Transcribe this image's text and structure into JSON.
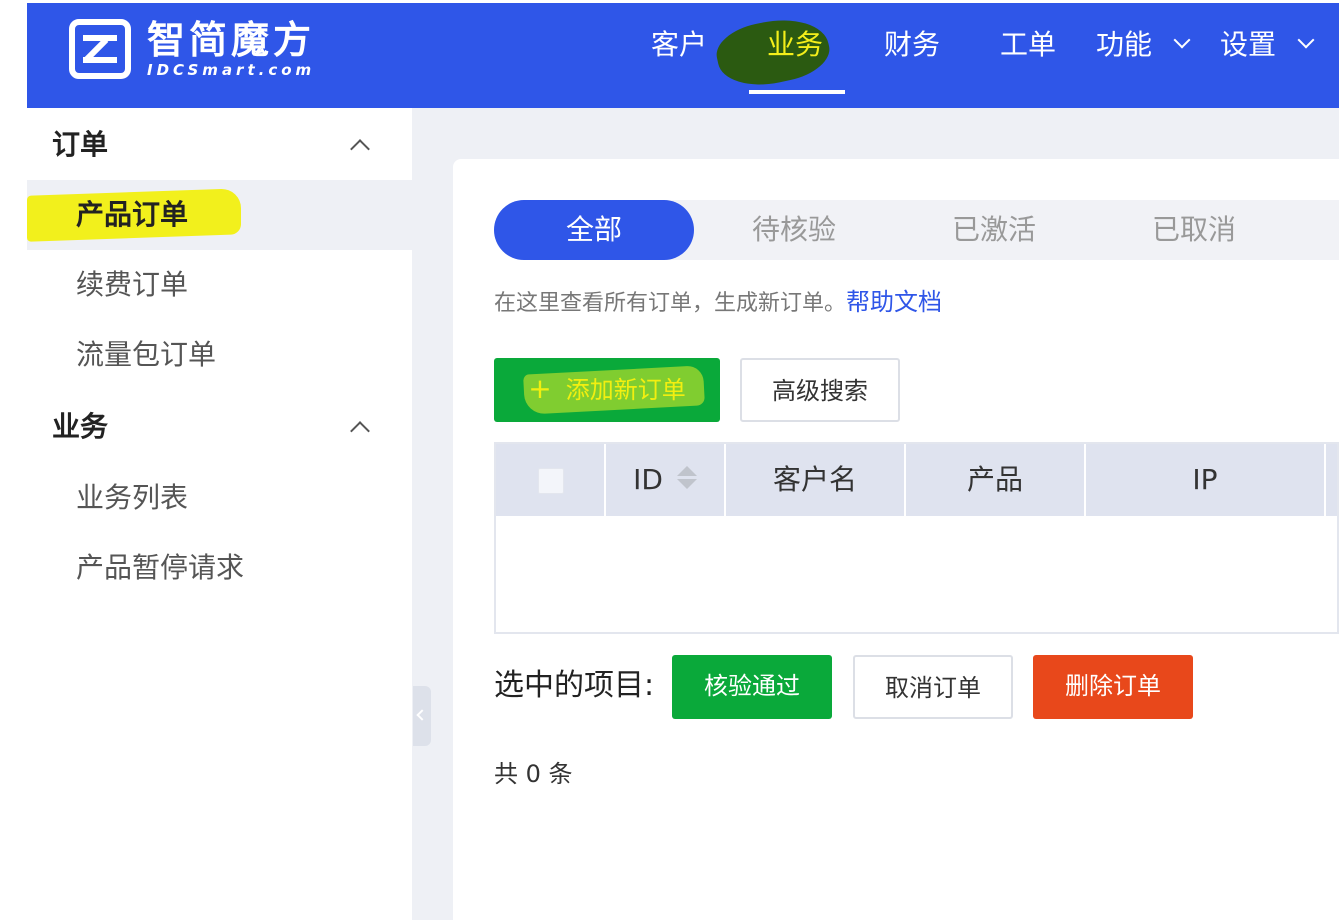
{
  "header": {
    "logo_cn": "智简魔方",
    "logo_en": "IDCSmart.com",
    "nav": [
      {
        "label": "客户"
      },
      {
        "label": "业务"
      },
      {
        "label": "财务"
      },
      {
        "label": "工单"
      },
      {
        "label": "功能"
      },
      {
        "label": "设置"
      }
    ],
    "active_nav": "业务",
    "highlight_color": "#f4ef1a"
  },
  "sidebar": {
    "groups": [
      {
        "title": "订单",
        "items": [
          "产品订单",
          "续费订单",
          "流量包订单"
        ]
      },
      {
        "title": "业务",
        "items": [
          "业务列表",
          "产品暂停请求"
        ]
      }
    ],
    "active_item": "产品订单"
  },
  "tabs": [
    "全部",
    "待核验",
    "已激活",
    "已取消"
  ],
  "active_tab": "全部",
  "intro": {
    "text": "在这里查看所有订单，生成新订单。",
    "help_link": "帮助文档"
  },
  "toolbar": {
    "add_label": "添加新订单",
    "add_icon": "plus-icon",
    "search_label": "高级搜索"
  },
  "table": {
    "columns": [
      "ID",
      "客户名",
      "产品",
      "IP"
    ],
    "rows": []
  },
  "bulk": {
    "label": "选中的项目:",
    "verify_label": "核验通过",
    "cancel_label": "取消订单",
    "delete_label": "删除订单"
  },
  "total_text": "共 0 条",
  "colors": {
    "primary": "#2f56e8",
    "success": "#0aa93a",
    "danger": "#e8481b"
  }
}
